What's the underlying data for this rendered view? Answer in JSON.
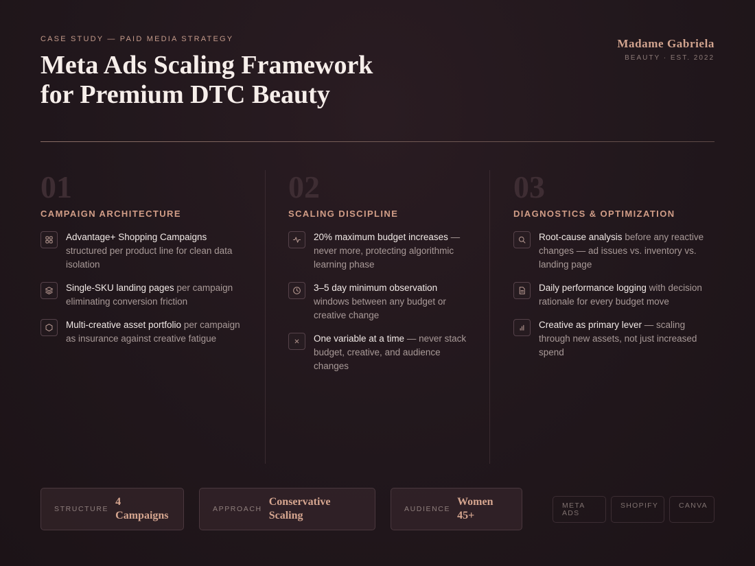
{
  "header": {
    "eyebrow": "CASE STUDY — PAID MEDIA STRATEGY",
    "title_line1": "Meta Ads Scaling Framework",
    "title_line2": "for Premium DTC Beauty"
  },
  "brand": {
    "name": "Madame Gabriela",
    "subtitle": "BEAUTY · EST. 2022"
  },
  "columns": [
    {
      "number": "01",
      "title": "CAMPAIGN ARCHITECTURE",
      "items": [
        {
          "icon": "grid-icon",
          "strong": "Advantage+ Shopping Campaigns",
          "text": " structured per product line for clean data isolation"
        },
        {
          "icon": "layers-icon",
          "strong": "Single-SKU landing pages",
          "text": " per campaign eliminating conversion friction"
        },
        {
          "icon": "hexagon-icon",
          "strong": "Multi-creative asset portfolio",
          "text": " per campaign as insurance against creative fatigue"
        }
      ]
    },
    {
      "number": "02",
      "title": "SCALING DISCIPLINE",
      "items": [
        {
          "icon": "activity-icon",
          "strong": "20% maximum budget increases",
          "text": " — never more, protecting algorithmic learning phase"
        },
        {
          "icon": "clock-icon",
          "strong": "3–5 day minimum observation",
          "text": " windows between any budget or creative change"
        },
        {
          "icon": "close-icon",
          "strong": "One variable at a time",
          "text": " — never stack budget, creative, and audience changes"
        }
      ]
    },
    {
      "number": "03",
      "title": "DIAGNOSTICS & OPTIMIZATION",
      "items": [
        {
          "icon": "search-icon",
          "strong": "Root-cause analysis",
          "text": " before any reactive changes — ad issues vs. inventory vs. landing page"
        },
        {
          "icon": "document-icon",
          "strong": "Daily performance logging",
          "text": " with decision rationale for every budget move"
        },
        {
          "icon": "bar-chart-icon",
          "strong": "Creative as primary lever",
          "text": " — scaling through new assets, not just increased spend"
        }
      ]
    }
  ],
  "stats": [
    {
      "label": "STRUCTURE",
      "value_line1": "4",
      "value_line2": "Campaigns"
    },
    {
      "label": "APPROACH",
      "value_line1": "Conservative",
      "value_line2": "Scaling"
    },
    {
      "label": "AUDIENCE",
      "value_line1": "Women",
      "value_line2": "45+"
    }
  ],
  "tools": [
    {
      "line1": "META",
      "line2": "ADS"
    },
    {
      "line1": "SHOPIFY",
      "line2": ""
    },
    {
      "line1": "CANVA",
      "line2": ""
    }
  ],
  "colors": {
    "background": "#21171c",
    "accent": "#d19d87",
    "heading": "#f6eeea",
    "muted": "#a99a98"
  }
}
